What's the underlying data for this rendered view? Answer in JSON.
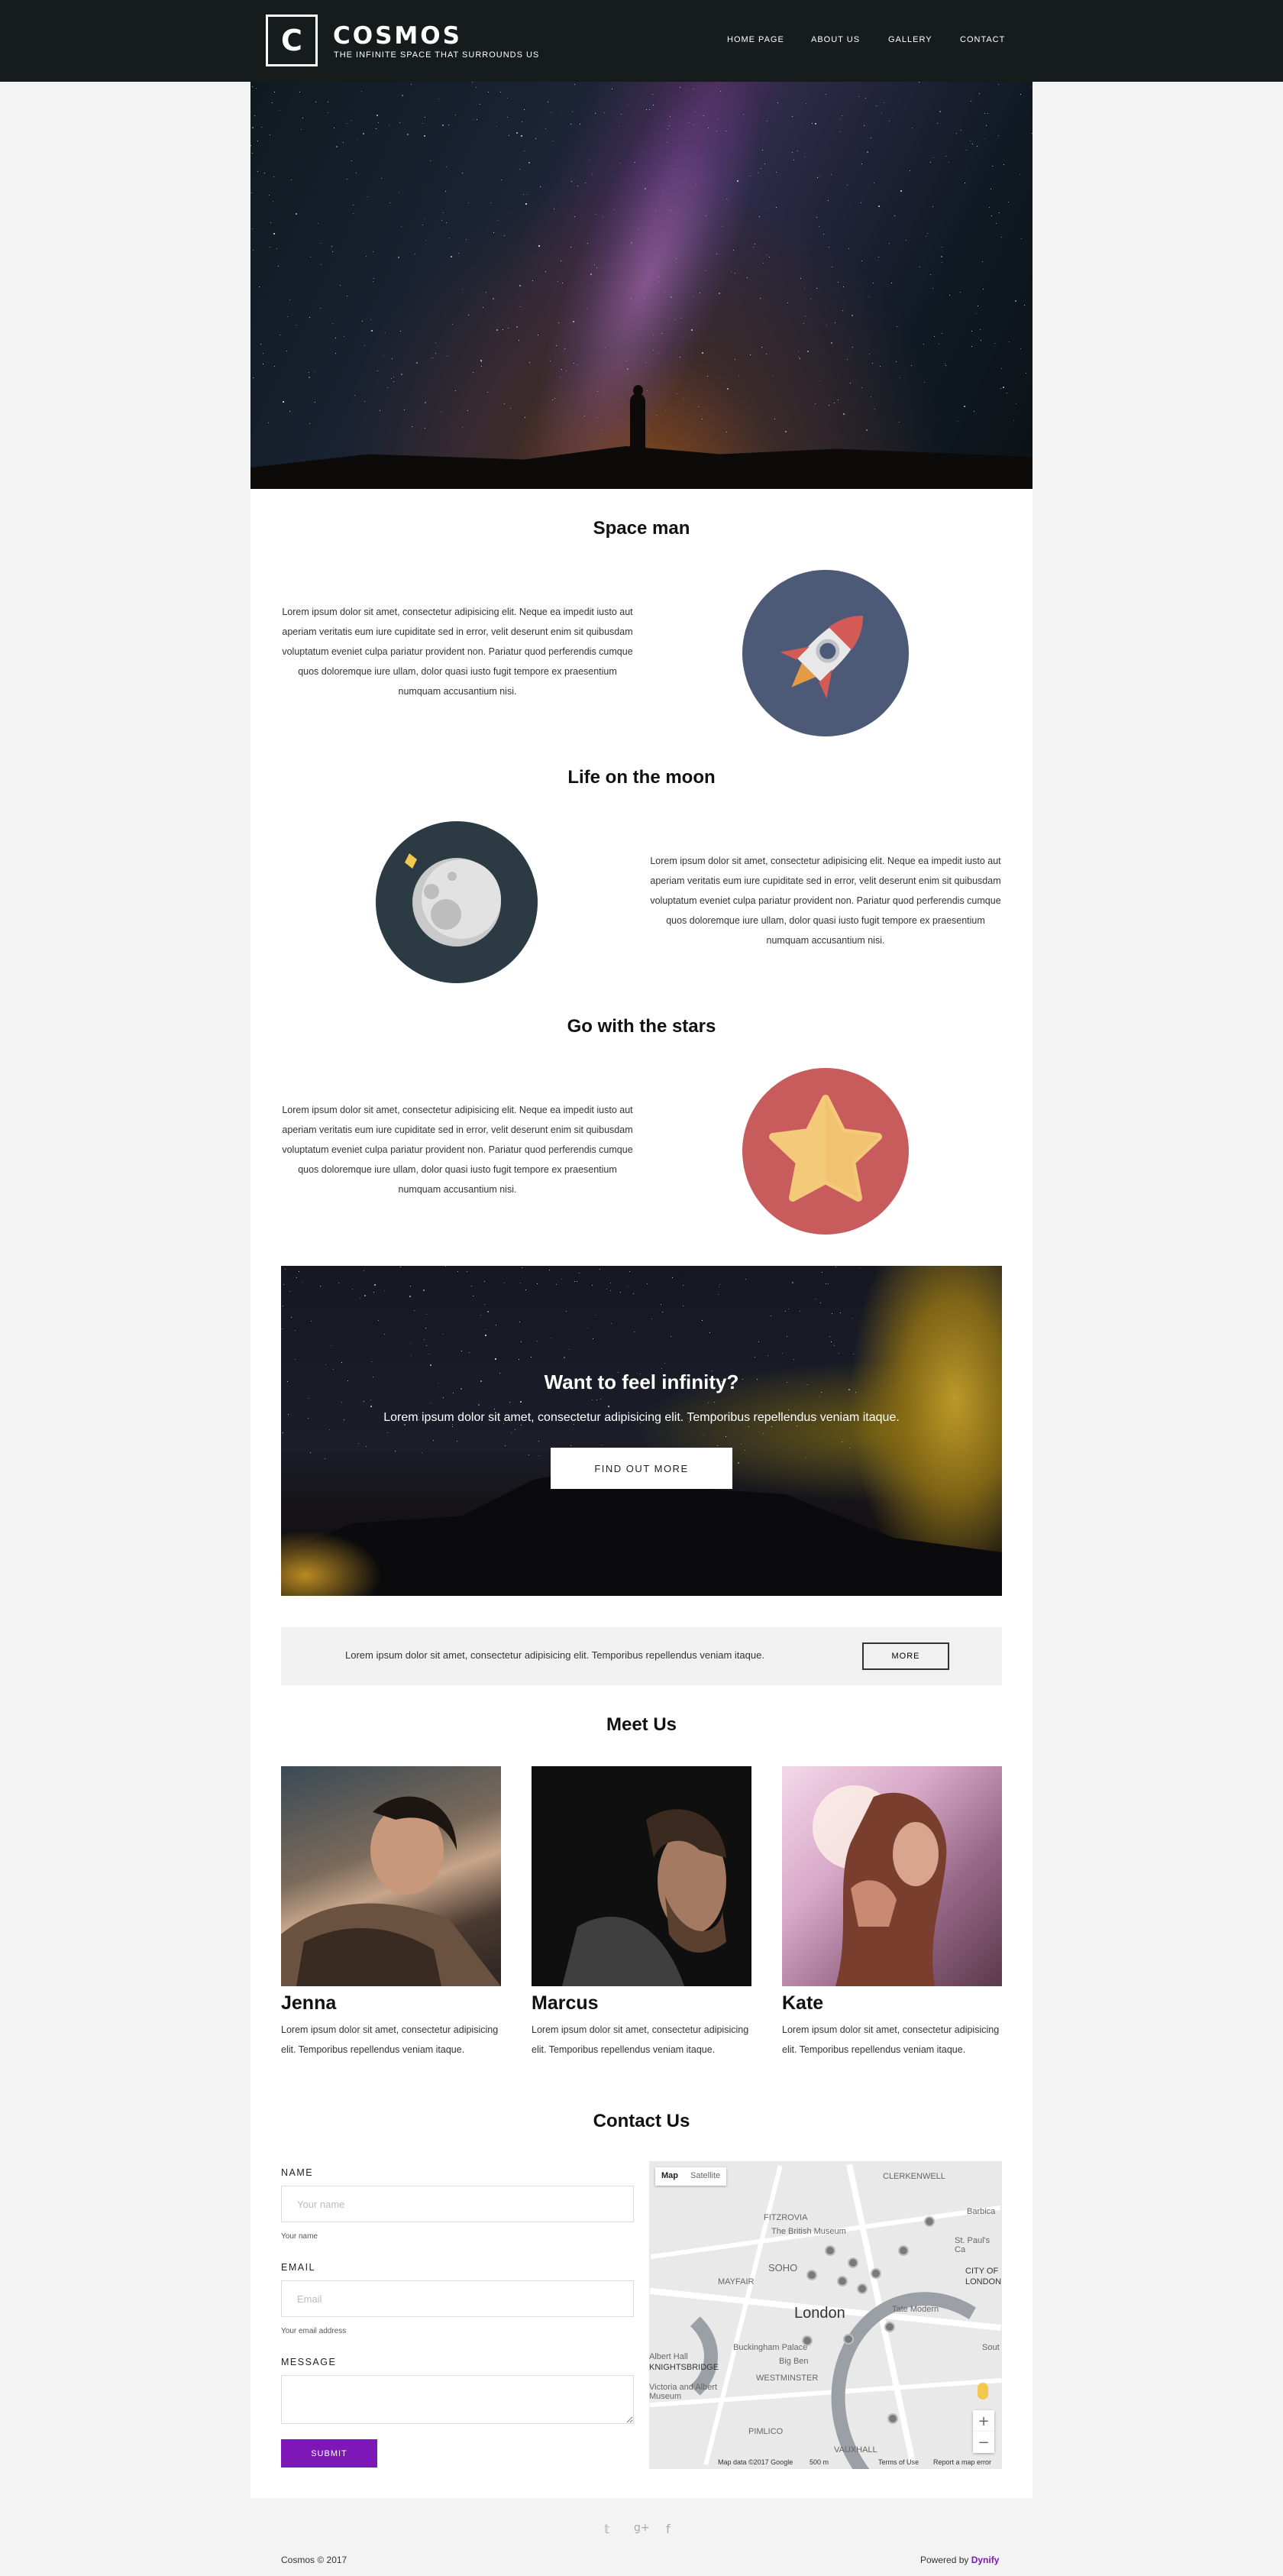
{
  "header": {
    "logo_letter": "C",
    "brand": "COSMOS",
    "tagline": "THE INFINITE SPACE THAT SURROUNDS US",
    "nav": [
      "HOME PAGE",
      "ABOUT US",
      "GALLERY",
      "CONTACT"
    ]
  },
  "features": [
    {
      "title": "Space man",
      "text": "Lorem ipsum dolor sit amet, consectetur adipisicing elit. Neque ea impedit iusto aut aperiam veritatis eum iure cupiditate sed in error, velit deserunt enim sit quibusdam voluptatum eveniet culpa pariatur provident non. Pariatur quod perferendis cumque quos doloremque iure ullam, dolor quasi iusto fugit tempore ex praesentium numquam accusantium nisi.",
      "icon": "rocket-icon"
    },
    {
      "title": "Life on the moon",
      "text": "Lorem ipsum dolor sit amet, consectetur adipisicing elit. Neque ea impedit iusto aut aperiam veritatis eum iure cupiditate sed in error, velit deserunt enim sit quibusdam voluptatum eveniet culpa pariatur provident non. Pariatur quod perferendis cumque quos doloremque iure ullam, dolor quasi iusto fugit tempore ex praesentium numquam accusantium nisi.",
      "icon": "moon-icon"
    },
    {
      "title": "Go with the stars",
      "text": "Lorem ipsum dolor sit amet, consectetur adipisicing elit. Neque ea impedit iusto aut aperiam veritatis eum iure cupiditate sed in error, velit deserunt enim sit quibusdam voluptatum eveniet culpa pariatur provident non. Pariatur quod perferendis cumque quos doloremque iure ullam, dolor quasi iusto fugit tempore ex praesentium numquam accusantium nisi.",
      "icon": "star-icon"
    }
  ],
  "cta": {
    "title": "Want to feel infinity?",
    "text": "Lorem ipsum dolor sit amet, consectetur adipisicing elit. Temporibus repellendus veniam itaque.",
    "button": "FIND OUT MORE"
  },
  "info_bar": {
    "text": "Lorem ipsum dolor sit amet, consectetur adipisicing elit. Temporibus repellendus veniam itaque.",
    "button": "MORE"
  },
  "team": {
    "title": "Meet Us",
    "members": [
      {
        "name": "Jenna",
        "text": "Lorem ipsum dolor sit amet, consectetur adipisicing elit. Temporibus repellendus veniam itaque."
      },
      {
        "name": "Marcus",
        "text": "Lorem ipsum dolor sit amet, consectetur adipisicing elit. Temporibus repellendus veniam itaque."
      },
      {
        "name": "Kate",
        "text": "Lorem ipsum dolor sit amet, consectetur adipisicing elit. Temporibus repellendus veniam itaque."
      }
    ]
  },
  "contact": {
    "title": "Contact Us",
    "name_label": "NAME",
    "name_placeholder": "Your name",
    "name_help": "Your name",
    "email_label": "EMAIL",
    "email_placeholder": "Email",
    "email_help": "Your email address",
    "message_label": "MESSAGE",
    "submit": "SUBMIT"
  },
  "map": {
    "type_map": "Map",
    "type_satellite": "Satellite",
    "labels": [
      "CLERKENWELL",
      "FITZROVIA",
      "The British Museum",
      "SOHO",
      "MAYFAIR",
      "London",
      "CITY OF",
      "LONDON",
      "Barbica",
      "St. Paul's Ca",
      "Buckingham Palace",
      "Big Ben",
      "WESTMINSTER",
      "KNIGHTSBRIDGE",
      "PIMLICO",
      "VAUXHALL",
      "Tate Modern",
      "Albert Hall",
      "Victoria and Albert Museum",
      "Sout"
    ],
    "zoom_in": "+",
    "zoom_out": "−",
    "footer": [
      "Map data ©2017 Google",
      "500 m",
      "Terms of Use",
      "Report a map error"
    ]
  },
  "footer": {
    "social": [
      "twitter-icon",
      "google-plus-icon",
      "facebook-icon"
    ],
    "social_glyphs": [
      "𝕥",
      "g+",
      "f"
    ],
    "copyright": "Cosmos © 2017",
    "powered_by": "Powered by",
    "powered_link": "Dynify"
  },
  "colors": {
    "header_bg": "#161c1c",
    "accent": "#7e17b8",
    "rocket_circle": "#4c5a78",
    "moon_circle": "#2b3a43",
    "star_circle": "#c85b5b"
  }
}
